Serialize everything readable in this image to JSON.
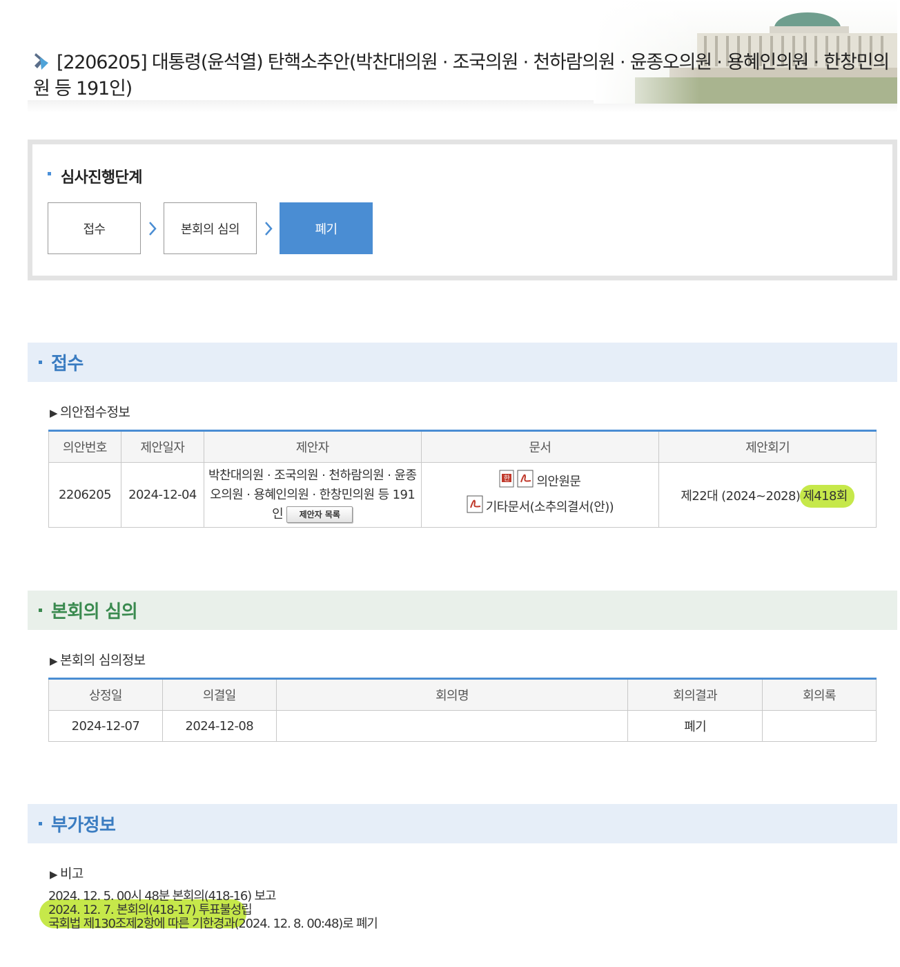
{
  "header": {
    "title": "[2206205] 대통령(윤석열) 탄핵소추안(박찬대의원 · 조국의원 · 천하람의원 · 윤종오의원 · 용혜인의원 · 한창민의원 등 191인)"
  },
  "stages": {
    "heading": "심사진행단계",
    "steps": [
      "접수",
      "본회의 심의",
      "폐기"
    ],
    "active_index": 2
  },
  "reception": {
    "section_title": "접수",
    "subheading": "의안접수정보",
    "columns": [
      "의안번호",
      "제안일자",
      "제안자",
      "문서",
      "제안회기"
    ],
    "row": {
      "bill_no": "2206205",
      "date": "2024-12-04",
      "proposer": "박찬대의원 · 조국의원 · 천하람의원 · 윤종오의원 · 용혜인의원 · 한창민의원 등 191인",
      "proposer_button": "제안자 목록",
      "doc1": "의안원문",
      "doc2": "기타문서(소추의결서(안))",
      "session_prefix": "제22대 (2024~2028)",
      "session_highlight": "제418회"
    }
  },
  "plenary": {
    "section_title": "본회의 심의",
    "subheading": "본회의 심의정보",
    "columns": [
      "상정일",
      "의결일",
      "회의명",
      "회의결과",
      "회의록"
    ],
    "row": {
      "presented": "2024-12-07",
      "decided": "2024-12-08",
      "meeting": "",
      "result": "폐기",
      "minutes": ""
    }
  },
  "additional": {
    "section_title": "부가정보",
    "subheading": "비고",
    "lines": [
      "2024. 12. 5. 00시 48분 본회의(418-16) 보고",
      "2024. 12. 7. 본회의(418-17) 투표불성립",
      "국회법 제130조제2항에 따른 기한경과(2024. 12. 8. 00:48)로 폐기"
    ]
  },
  "colors": {
    "accent_blue": "#4a8dd3",
    "highlight_green": "#c6e84a",
    "section_blue_bg": "#e6eef8",
    "section_green_bg": "#e9f0ea"
  }
}
